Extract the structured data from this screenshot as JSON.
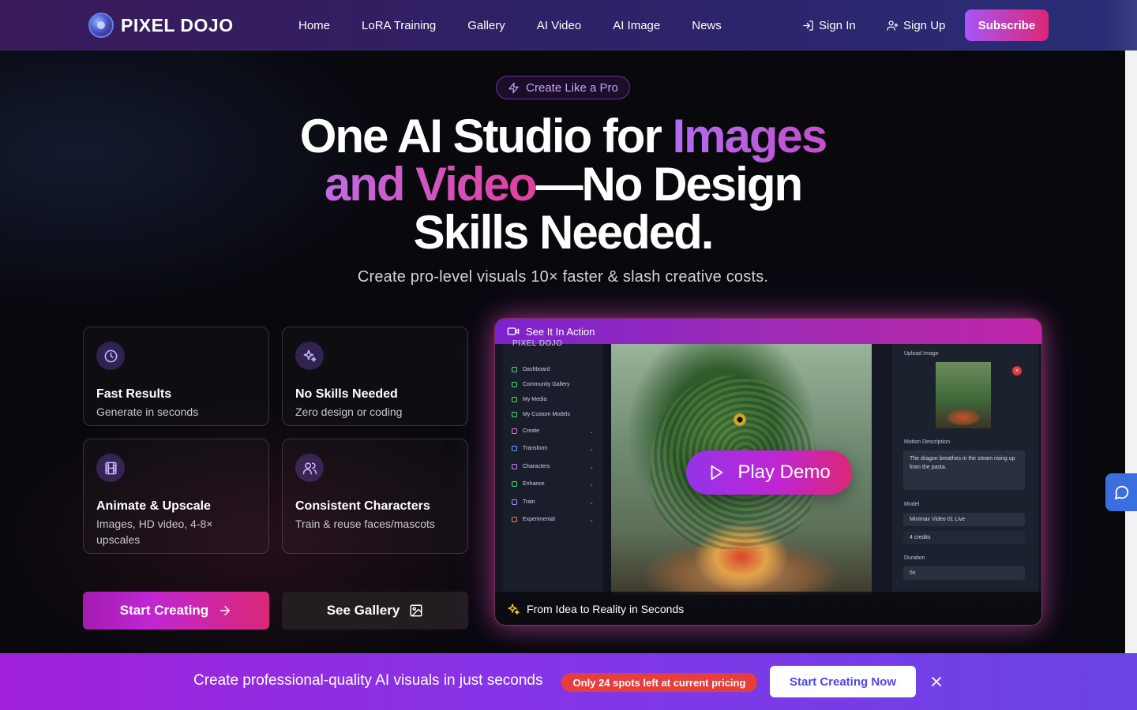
{
  "nav": {
    "brand": "PIXEL DOJO",
    "links": [
      "Home",
      "LoRA Training",
      "Gallery",
      "AI Video",
      "AI Image",
      "News"
    ],
    "sign_in": "Sign In",
    "sign_up": "Sign Up",
    "subscribe": "Subscribe"
  },
  "hero": {
    "pill": "Create Like a Pro",
    "headline": {
      "part1": "One AI Studio for ",
      "grad1": "Images",
      "grad2": "and Video",
      "part2": "—No Design",
      "part3": "Skills Needed."
    },
    "subhead": "Create pro-level visuals 10× faster & slash creative costs."
  },
  "features": [
    {
      "title": "Fast Results",
      "desc": "Generate in seconds",
      "icon": "clock-icon"
    },
    {
      "title": "No Skills Needed",
      "desc": "Zero design or coding",
      "icon": "sparkles-icon"
    },
    {
      "title": "Animate & Upscale",
      "desc": "Images, HD video, 4-8× upscales",
      "icon": "film-icon"
    },
    {
      "title": "Consistent Characters",
      "desc": "Train & reuse faces/mascots",
      "icon": "users-icon"
    }
  ],
  "cta": {
    "start": "Start Creating",
    "gallery": "See Gallery"
  },
  "demo": {
    "header": "See It In Action",
    "play": "Play Demo",
    "footer": "From Idea to Reality in Seconds",
    "sidebar": {
      "brand": "PIXEL DOJO",
      "items": [
        "Dashboard",
        "Community Gallery",
        "My Media",
        "My Custom Models",
        "Create",
        "Transform",
        "Characters",
        "Enhance",
        "Train",
        "Experimental"
      ]
    },
    "panel": {
      "upload_label": "Upload Image",
      "motion_label": "Motion Description",
      "motion_text": "The dragon breathes in the steam rising up from the pasta.",
      "model_label": "Model",
      "model_value": "Minimax Video 01 Live",
      "credits": "4 credits",
      "duration_label": "Duration",
      "duration_value": "5s"
    }
  },
  "banner": {
    "text": "Create professional-quality AI visuals in just seconds",
    "badge": "Only 24 spots left at current pricing",
    "button": "Start Creating Now"
  },
  "colors": {
    "accent_purple": "#a855f7",
    "accent_pink": "#db2777",
    "chat_blue": "#3b6fe0",
    "badge_red": "#e53e3e"
  }
}
